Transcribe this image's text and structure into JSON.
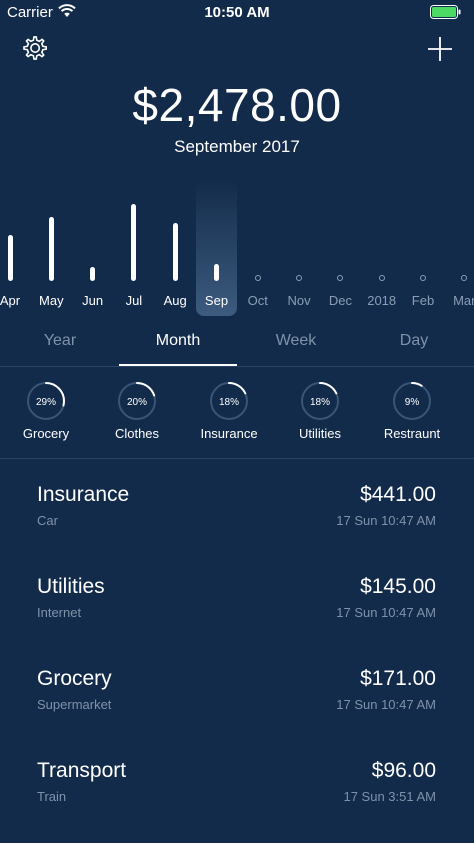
{
  "status_bar": {
    "carrier": "Carrier",
    "time": "10:50 AM",
    "battery_color": "#4cd964"
  },
  "header": {
    "settings_icon": "gear-icon",
    "add_icon": "plus-icon",
    "total": "$2,478.00",
    "period": "September 2017"
  },
  "chart_data": {
    "type": "bar",
    "categories": [
      "Apr",
      "May",
      "Jun",
      "Jul",
      "Aug",
      "Sep",
      "Oct",
      "Nov",
      "Dec",
      "2018",
      "Feb",
      "Mar"
    ],
    "values": [
      45,
      62,
      14,
      75,
      57,
      17,
      null,
      null,
      null,
      null,
      null,
      null
    ],
    "selected": "Sep",
    "highlight_color": "#5a7fa6"
  },
  "tabs": [
    {
      "label": "Year",
      "active": false
    },
    {
      "label": "Month",
      "active": true
    },
    {
      "label": "Week",
      "active": false
    },
    {
      "label": "Day",
      "active": false
    }
  ],
  "categories": [
    {
      "name": "Grocery",
      "percent": "29%",
      "fraction": 0.29
    },
    {
      "name": "Clothes",
      "percent": "20%",
      "fraction": 0.2
    },
    {
      "name": "Insurance",
      "percent": "18%",
      "fraction": 0.18
    },
    {
      "name": "Utilities",
      "percent": "18%",
      "fraction": 0.18
    },
    {
      "name": "Restraunt",
      "percent": "9%",
      "fraction": 0.09
    }
  ],
  "transactions": [
    {
      "name": "Insurance",
      "sub": "Car",
      "amount": "$441.00",
      "time": "17 Sun 10:47 AM"
    },
    {
      "name": "Utilities",
      "sub": "Internet",
      "amount": "$145.00",
      "time": "17 Sun 10:47 AM"
    },
    {
      "name": "Grocery",
      "sub": "Supermarket",
      "amount": "$171.00",
      "time": "17 Sun 10:47 AM"
    },
    {
      "name": "Transport",
      "sub": "Train",
      "amount": "$96.00",
      "time": "17 Sun 3:51 AM"
    }
  ]
}
